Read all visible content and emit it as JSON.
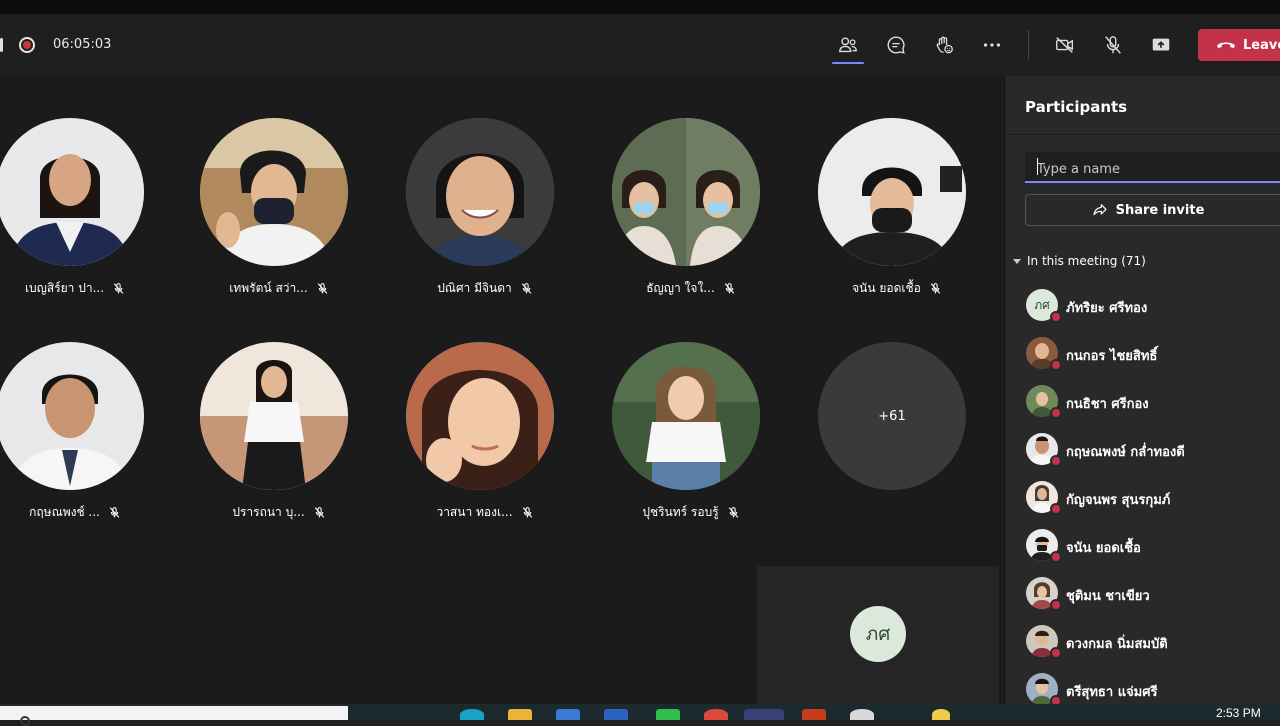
{
  "meeting": {
    "timer": "06:05:03",
    "leave_label": "Leave"
  },
  "stage": {
    "tiles": [
      {
        "name": "เบญสิร์ยา ปา...",
        "avatar": "photo"
      },
      {
        "name": "เทพรัตน์ สว่า...",
        "avatar": "photo"
      },
      {
        "name": "ปณิศา มีจินดา",
        "avatar": "photo"
      },
      {
        "name": "ธัญญา ใจใ...",
        "avatar": "photo"
      },
      {
        "name": "จนัน ยอดเชื้อ",
        "avatar": "photo"
      },
      {
        "name": "กฤษณพงช์ ...",
        "avatar": "photo"
      },
      {
        "name": "ปรารถนา บุ...",
        "avatar": "photo"
      },
      {
        "name": "วาสนา ทองเ...",
        "avatar": "photo"
      },
      {
        "name": "ปุชรินทร์ รอบรู้",
        "avatar": "photo"
      }
    ],
    "overflow_label": "+61",
    "self_initials": "ภศ"
  },
  "panel": {
    "title": "Participants",
    "search_placeholder": "Type a name",
    "share_label": "Share invite",
    "section_label": "In this meeting (71)",
    "participants": [
      {
        "name": "ภัทริยะ ศรีทอง",
        "initials": "ภศ"
      },
      {
        "name": "กนกอร ไชยสิทธิ์",
        "initials": ""
      },
      {
        "name": "กนธิชา ศรีกอง",
        "initials": ""
      },
      {
        "name": "กฤษณพงษ์ กล่ำทองดี",
        "initials": ""
      },
      {
        "name": "กัญจนพร สุนรกุมภ์",
        "initials": ""
      },
      {
        "name": "จนัน ยอดเชื้อ",
        "initials": ""
      },
      {
        "name": "ชุติมน ชาเขียว",
        "initials": ""
      },
      {
        "name": "ดวงกมล นิ่มสมบัติ",
        "initials": ""
      },
      {
        "name": "ตรีสุทธา แจ่มศรี",
        "initials": ""
      }
    ]
  },
  "taskbar": {
    "clock": "2:53 PM"
  },
  "colors": {
    "accent": "#7f85f5",
    "leave": "#c4314b",
    "status_busy": "#c4314b"
  }
}
